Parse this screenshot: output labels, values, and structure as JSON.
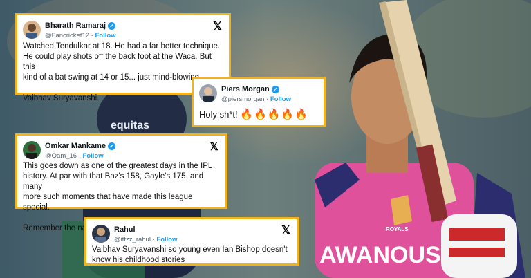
{
  "colors": {
    "card_border": "#f2b21c",
    "follow": "#1d9bf0",
    "verified": "#1d9bf0",
    "jersey": "#e0519b"
  },
  "background": {
    "jersey_text": "AWANOUS",
    "logo_text": "ROYALS",
    "opponent_text": "equitas"
  },
  "tweets": [
    {
      "name": "Bharath Ramaraj",
      "handle": "@Fancricket12",
      "follow_label": "Follow",
      "verified": true,
      "icon": "x-logo-icon",
      "lines": [
        "Watched Tendulkar at 18. He had a far better technique.",
        "He could play shots off the back foot at the Waca. But this",
        "kind of a bat swing at 14 or 15... just mind-blowing.",
        "",
        "Vaibhav Suryavanshi."
      ]
    },
    {
      "name": "Piers Morgan",
      "handle": "@piersmorgan",
      "follow_label": "Follow",
      "verified": true,
      "icon": "x-logo-icon",
      "text": "Holy sh*t!",
      "emoji": "🔥🔥🔥🔥🔥"
    },
    {
      "name": "Omkar Mankame",
      "handle": "@Oam_16",
      "follow_label": "Follow",
      "verified": true,
      "icon": "x-logo-icon",
      "lines": [
        "This goes down as one of the greatest days in the IPL",
        "history. At par with that Baz's 158, Gayle's 175, and many",
        "more such moments that have made this league special.",
        "",
        "Remember the name, Vaibhav Suryavanshi!"
      ]
    },
    {
      "name": "Rahul",
      "handle": "@ittzz_rahul",
      "follow_label": "Follow",
      "verified": false,
      "icon": "x-logo-icon",
      "lines": [
        "Vaibhav Suryavanshi so young even Ian Bishop doesn't",
        "know his childhood stories"
      ]
    }
  ]
}
